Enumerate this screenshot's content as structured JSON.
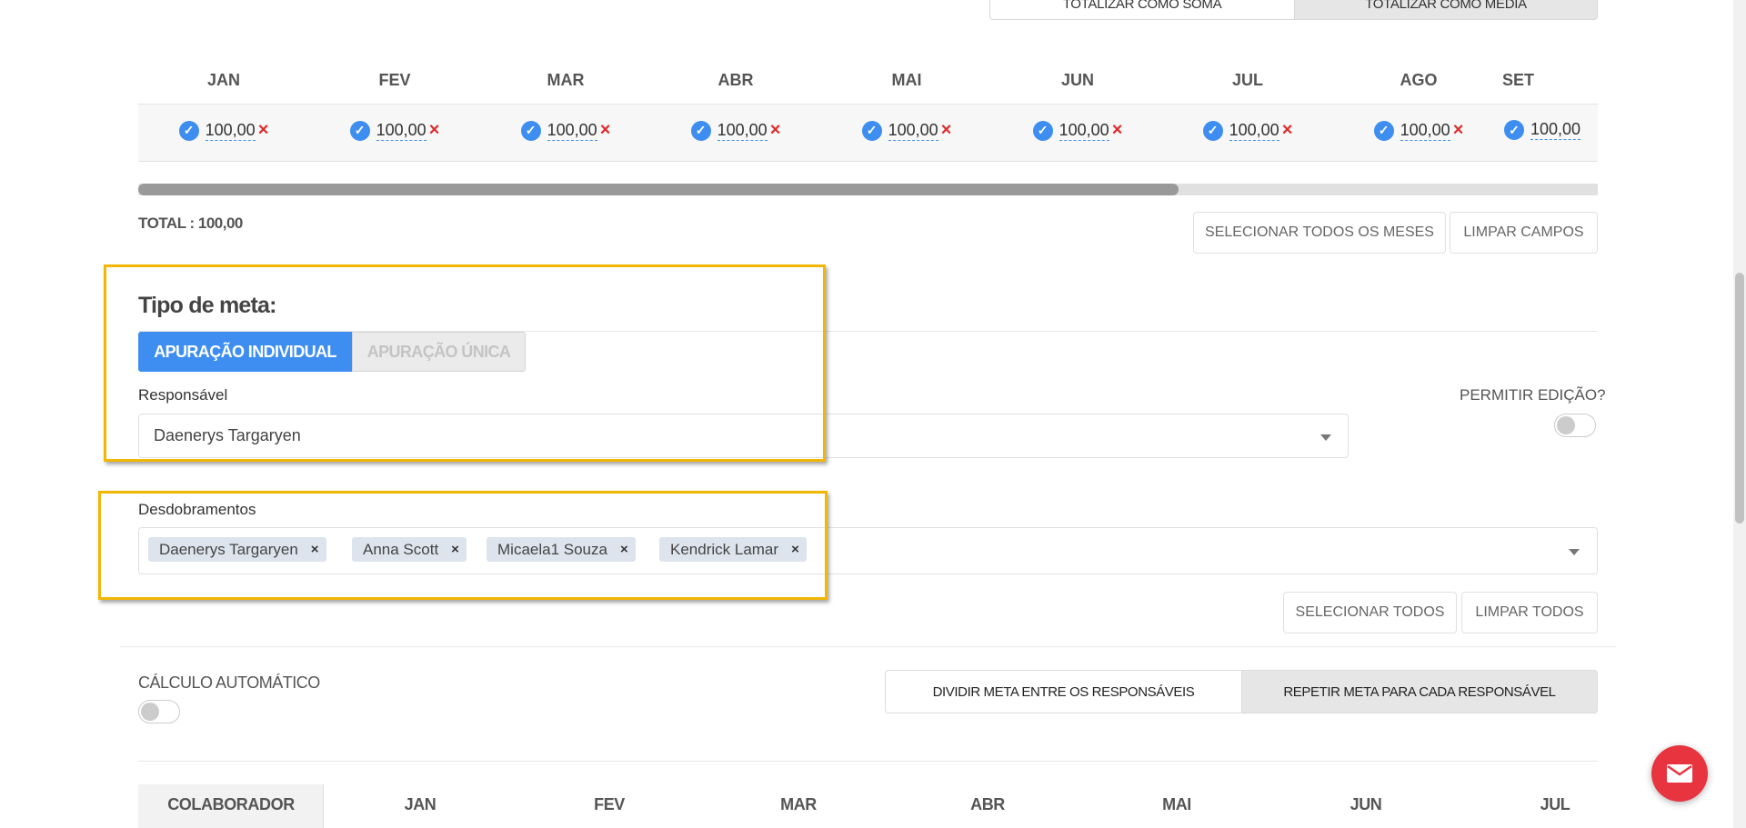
{
  "top_buttons": {
    "sum": "TOTALIZAR COMO SOMA",
    "avg": "TOTALIZAR COMO MÉDIA"
  },
  "months_table": {
    "months": [
      "JAN",
      "FEV",
      "MAR",
      "ABR",
      "MAI",
      "JUN",
      "JUL",
      "AGO",
      "SET"
    ],
    "values": [
      "100,00",
      "100,00",
      "100,00",
      "100,00",
      "100,00",
      "100,00",
      "100,00",
      "100,00",
      "100,00"
    ],
    "remove_symbol": "×"
  },
  "scroll_progress": 0.713,
  "total": "TOTAL : 100,00",
  "month_actions": {
    "select_all": "SELECIONAR TODOS OS MESES",
    "clear": "LIMPAR CAMPOS"
  },
  "goal_type": {
    "title": "Tipo de meta:",
    "options": [
      "APURAÇÃO INDIVIDUAL",
      "APURAÇÃO ÚNICA"
    ],
    "selected": "APURAÇÃO INDIVIDUAL"
  },
  "responsible": {
    "label": "Responsável",
    "value": "Daenerys Targaryen"
  },
  "allow_edit": {
    "label": "PERMITIR EDIÇÃO?",
    "enabled": false
  },
  "breakdowns": {
    "label": "Desdobramentos",
    "tags": [
      "Daenerys Targaryen",
      "Anna Scott",
      "Micaela1 Souza",
      "Kendrick Lamar"
    ],
    "remove_symbol": "×",
    "select_all": "SELECIONAR TODOS",
    "clear_all": "LIMPAR TODOS"
  },
  "auto_calc": {
    "label": "CÁLCULO AUTOMÁTICO",
    "enabled": false
  },
  "distribution": {
    "options": [
      "DIVIDIR META ENTRE OS RESPONSÁVEIS",
      "REPETIR META PARA CADA RESPONSÁVEL"
    ],
    "selected": "REPETIR META PARA CADA RESPONSÁVEL"
  },
  "collab_table": {
    "headers": [
      "COLABORADOR",
      "JAN",
      "FEV",
      "MAR",
      "ABR",
      "MAI",
      "JUN",
      "JUL"
    ]
  },
  "colors": {
    "primary": "#3d8ef0",
    "highlight": "#f2b705",
    "danger": "#e02b2b",
    "fab": "#e8343f"
  },
  "icons": {
    "check": "check-icon",
    "remove": "close-icon",
    "dropdown": "chevron-down-icon",
    "fab": "envelope-icon"
  }
}
